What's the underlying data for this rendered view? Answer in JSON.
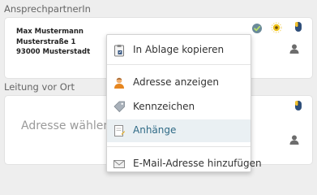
{
  "contact_section": {
    "label": "AnsprechpartnerIn",
    "address_lines": [
      "Max Mustermann",
      "Musterstraße 1",
      "93000 Musterstadt"
    ]
  },
  "site_section": {
    "label": "Leitung vor Ort",
    "placeholder": "Adresse wählen"
  },
  "context_menu": {
    "items": [
      {
        "label": "In Ablage kopieren",
        "icon": "clipboard-icon"
      },
      {
        "label": "Adresse anzeigen",
        "icon": "person-icon"
      },
      {
        "label": "Kennzeichen",
        "icon": "tag-icon"
      },
      {
        "label": "Anhänge",
        "icon": "document-icon"
      },
      {
        "label": "E-Mail-Adresse hinzufügen",
        "icon": "envelope-icon"
      }
    ]
  },
  "colors": {
    "highlight_bg": "#eaf0f3",
    "highlight_text": "#2f6a86"
  }
}
